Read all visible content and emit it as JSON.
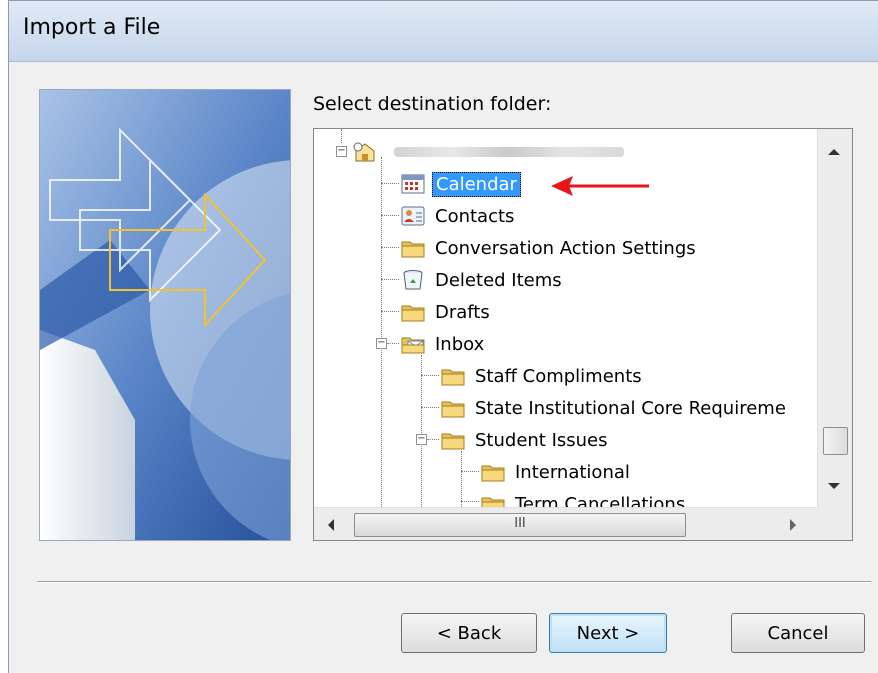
{
  "window": {
    "title": "Import a File"
  },
  "prompt": "Select destination folder:",
  "tree": {
    "root_label": "",
    "items": [
      {
        "label": "Calendar",
        "icon": "calendar-icon",
        "selected": true
      },
      {
        "label": "Contacts",
        "icon": "contacts-icon"
      },
      {
        "label": "Conversation Action Settings",
        "icon": "folder-icon"
      },
      {
        "label": "Deleted Items",
        "icon": "recycle-bin-icon"
      },
      {
        "label": "Drafts",
        "icon": "folder-icon"
      },
      {
        "label": "Inbox",
        "icon": "inbox-folder-icon"
      },
      {
        "label": "Staff Compliments",
        "icon": "folder-icon"
      },
      {
        "label": "State Institutional Core Requireme",
        "icon": "folder-icon"
      },
      {
        "label": "Student Issues",
        "icon": "folder-icon"
      },
      {
        "label": "International",
        "icon": "folder-icon"
      },
      {
        "label": "Term Cancellations",
        "icon": "folder-icon"
      }
    ]
  },
  "scroll": {
    "h_thumb_glyph": "III"
  },
  "buttons": {
    "back": "< Back",
    "next": "Next >",
    "cancel": "Cancel"
  },
  "colors": {
    "selection": "#3399ff",
    "annotation_arrow": "#e8161b",
    "title_bar": "#c6d6ea"
  }
}
